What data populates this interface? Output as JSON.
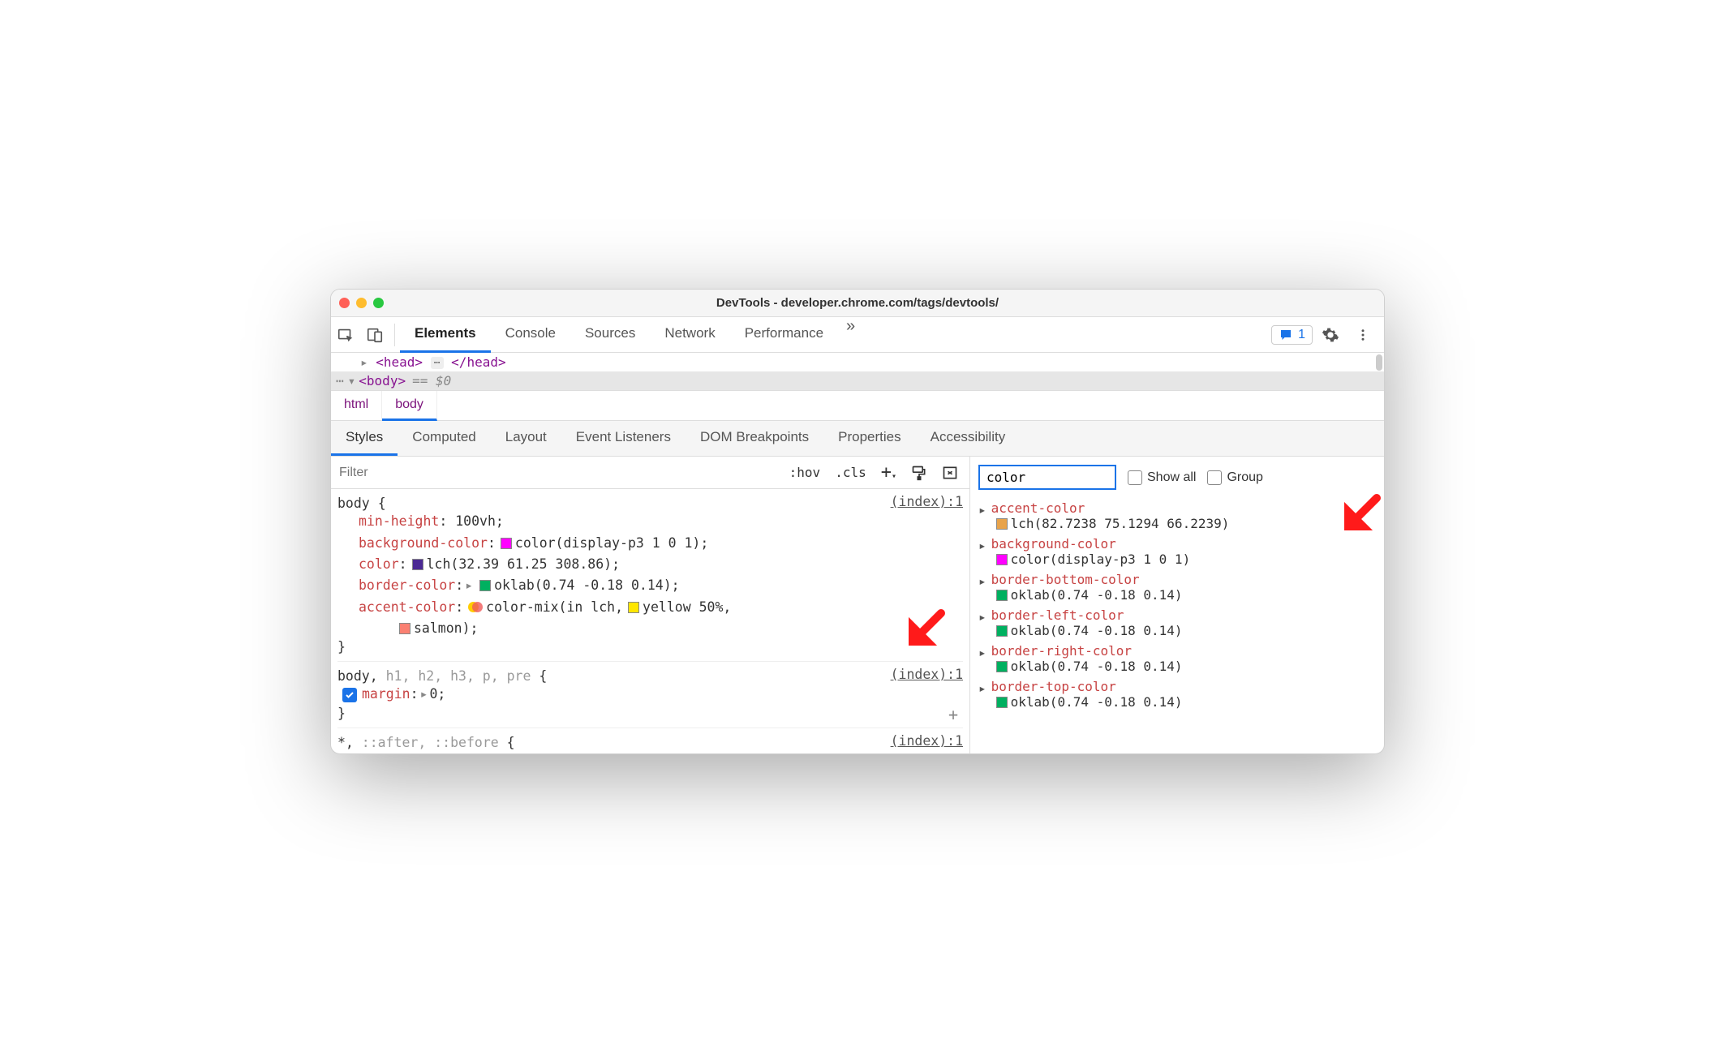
{
  "window": {
    "title": "DevTools - developer.chrome.com/tags/devtools/"
  },
  "tabs": [
    "Elements",
    "Console",
    "Sources",
    "Network",
    "Performance"
  ],
  "issues_badge": "1",
  "dom": {
    "head_open": "<head>",
    "head_close": "</head>",
    "body_open": "<body>",
    "eq": "== $0"
  },
  "crumbs": [
    "html",
    "body"
  ],
  "subtabs": [
    "Styles",
    "Computed",
    "Layout",
    "Event Listeners",
    "DOM Breakpoints",
    "Properties",
    "Accessibility"
  ],
  "filter": {
    "placeholder": "Filter",
    "hov": ":hov",
    "cls": ".cls"
  },
  "rules": {
    "r1": {
      "selector": "body",
      "source": "(index):1",
      "d1_prop": "min-height",
      "d1_val": "100vh",
      "d2_prop": "background-color",
      "d2_val": "color(display-p3 1 0 1)",
      "d3_prop": "color",
      "d3_val": "lch(32.39 61.25 308.86)",
      "d4_prop": "border-color",
      "d4_val": "oklab(0.74 -0.18 0.14)",
      "d5_prop": "accent-color",
      "d5_val_a": "color-mix(in lch,",
      "d5_yellow": "yellow 50%",
      "d5_salmon": "salmon)"
    },
    "r2": {
      "selector_pre": "body,",
      "selector_gray": " h1, h2, h3, p, pre",
      "source": "(index):1",
      "d1_prop": "margin",
      "d1_val": "0"
    },
    "r3": {
      "selector_star": "*,",
      "selector_gray": " ::after, ::before",
      "source": "(index):1"
    }
  },
  "computed": {
    "filter_value": "color",
    "show_all": "Show all",
    "group": "Group",
    "items": [
      {
        "prop": "accent-color",
        "swatch": "sw-orange",
        "val": "lch(82.7238 75.1294 66.2239)"
      },
      {
        "prop": "background-color",
        "swatch": "sw-magenta",
        "val": "color(display-p3 1 0 1)"
      },
      {
        "prop": "border-bottom-color",
        "swatch": "sw-green",
        "val": "oklab(0.74 -0.18 0.14)"
      },
      {
        "prop": "border-left-color",
        "swatch": "sw-green",
        "val": "oklab(0.74 -0.18 0.14)"
      },
      {
        "prop": "border-right-color",
        "swatch": "sw-green",
        "val": "oklab(0.74 -0.18 0.14)"
      },
      {
        "prop": "border-top-color",
        "swatch": "sw-green",
        "val": "oklab(0.74 -0.18 0.14)"
      }
    ]
  }
}
